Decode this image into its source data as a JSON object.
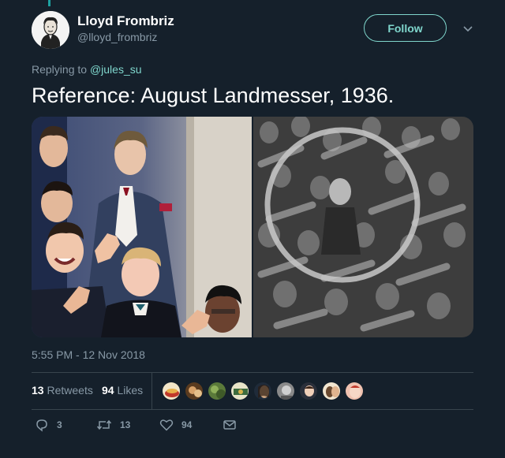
{
  "tweet": {
    "display_name": "Lloyd Frombriz",
    "handle": "@lloyd_frombriz",
    "follow_label": "Follow",
    "replying_prefix": "Replying to",
    "replying_to": "@jules_su",
    "text": "Reference: August Landmesser, 1936.",
    "timestamp": "5:55 PM - 12 Nov 2018"
  },
  "stats": {
    "retweets_count": "13",
    "retweets_label": "Retweets",
    "likes_count": "94",
    "likes_label": "Likes"
  },
  "actions": {
    "reply_count": "3",
    "retweet_count": "13",
    "like_count": "94"
  },
  "colors": {
    "background": "#15202b",
    "accent": "#7fd6cc",
    "muted": "#8899a6",
    "divider": "#38444d"
  },
  "icons": [
    "reply-icon",
    "retweet-icon",
    "heart-icon",
    "envelope-icon",
    "chevron-down-icon"
  ]
}
